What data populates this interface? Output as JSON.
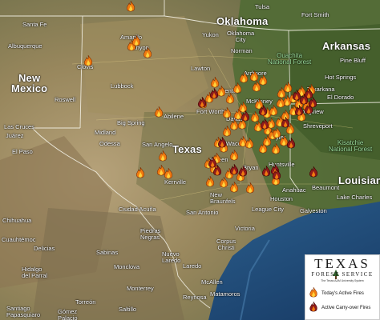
{
  "map": {
    "states": [
      {
        "key": "oklahoma",
        "name": "Oklahoma"
      },
      {
        "key": "arkansas",
        "name": "Arkansas"
      },
      {
        "key": "new_mexico",
        "name": "New\nMexico"
      },
      {
        "key": "texas",
        "name": "Texas"
      },
      {
        "key": "louisiana",
        "name": "Louisiana"
      }
    ],
    "national_forests": [
      {
        "key": "ouachita",
        "name": "Ouachita\nNational Forest"
      },
      {
        "key": "kisatchie",
        "name": "Kisatchie\nNational Forest"
      }
    ],
    "cities": [
      {
        "key": "tulsa",
        "name": "Tulsa"
      },
      {
        "key": "oklahoma_city",
        "name": "Oklahoma\nCity"
      },
      {
        "key": "lawton",
        "name": "Lawton"
      },
      {
        "key": "yukon",
        "name": "Yukon"
      },
      {
        "key": "ardmore",
        "name": "Ardmore"
      },
      {
        "key": "fort_smith",
        "name": "Fort Smith"
      },
      {
        "key": "amarillo",
        "name": "Amarillo"
      },
      {
        "key": "canyon",
        "name": "Canyon"
      },
      {
        "key": "santa_fe",
        "name": "Santa Fe"
      },
      {
        "key": "albuquerque",
        "name": "Albuquerque"
      },
      {
        "key": "hot_springs",
        "name": "Hot Springs"
      },
      {
        "key": "pine_bluff",
        "name": "Pine Bluff"
      },
      {
        "key": "el_dorado",
        "name": "El Dorado"
      },
      {
        "key": "lubbock",
        "name": "Lubbock"
      },
      {
        "key": "clovis",
        "name": "Clovis"
      },
      {
        "key": "roswell",
        "name": "Roswell"
      },
      {
        "key": "las_cruces",
        "name": "Las Cruces"
      },
      {
        "key": "juarez",
        "name": "Juárez"
      },
      {
        "key": "el_paso",
        "name": "El Paso"
      },
      {
        "key": "midland",
        "name": "Midland"
      },
      {
        "key": "odessa",
        "name": "Odessa"
      },
      {
        "key": "big_spring",
        "name": "Big Spring"
      },
      {
        "key": "abilene",
        "name": "Abilene"
      },
      {
        "key": "fort_worth",
        "name": "Fort Worth"
      },
      {
        "key": "dallas",
        "name": "Dallas"
      },
      {
        "key": "mckinney",
        "name": "McKinney"
      },
      {
        "key": "denton",
        "name": "Denton"
      },
      {
        "key": "tyler",
        "name": "Tyler"
      },
      {
        "key": "shreveport",
        "name": "Shreveport"
      },
      {
        "key": "longview",
        "name": "Longview"
      },
      {
        "key": "san_angelo",
        "name": "San Angelo"
      },
      {
        "key": "waco",
        "name": "Waco"
      },
      {
        "key": "killeen",
        "name": "Killeen"
      },
      {
        "key": "bryan",
        "name": "Bryan"
      },
      {
        "key": "huntsville",
        "name": "Huntsville"
      },
      {
        "key": "kerrville",
        "name": "Kerrville"
      },
      {
        "key": "new_braunfels",
        "name": "New\nBraunfels"
      },
      {
        "key": "san_antonio",
        "name": "San Antonio"
      },
      {
        "key": "houston",
        "name": "Houston"
      },
      {
        "key": "league_city",
        "name": "League City"
      },
      {
        "key": "galveston",
        "name": "Galveston"
      },
      {
        "key": "beaumont",
        "name": "Beaumont"
      },
      {
        "key": "lake_charles",
        "name": "Lake Charles"
      },
      {
        "key": "victoria",
        "name": "Victoria"
      },
      {
        "key": "corpus_christi",
        "name": "Corpus\nChristi"
      },
      {
        "key": "chihuahua",
        "name": "Chihuahua"
      },
      {
        "key": "cuauhtemoc",
        "name": "Cuauhtémoc"
      },
      {
        "key": "delicias",
        "name": "Delicias"
      },
      {
        "key": "ciudad_acuna",
        "name": "Ciudad Acuña"
      },
      {
        "key": "piedras_negras",
        "name": "Piedras\nNegras"
      },
      {
        "key": "nuevo_laredo",
        "name": "Nuevo\nLaredo"
      },
      {
        "key": "laredo",
        "name": "Laredo"
      },
      {
        "key": "hidalgo_del_parral",
        "name": "Hidalgo\ndel Parral"
      },
      {
        "key": "monclova",
        "name": "Monclova"
      },
      {
        "key": "monterrey",
        "name": "Monterrey"
      },
      {
        "key": "reynosa",
        "name": "Reynosa"
      },
      {
        "key": "matamoros",
        "name": "Matamoros"
      },
      {
        "key": "mcallen",
        "name": "McAllen"
      },
      {
        "key": "saltillo",
        "name": "Saltillo"
      },
      {
        "key": "torreon",
        "name": "Torreón"
      },
      {
        "key": "santiago_papasquiaro",
        "name": "Santiago\nPapasquiaro"
      },
      {
        "key": "gomez_palacio",
        "name": "Gómez\nPalacio"
      },
      {
        "key": "sabinas",
        "name": "Sabinas"
      },
      {
        "key": "anahuac",
        "name": "Anahuac"
      },
      {
        "key": "texarkana",
        "name": "Texarkana"
      },
      {
        "key": "norman",
        "name": "Norman"
      }
    ]
  },
  "legend": {
    "org_title": "TEXAS",
    "org_subtitle": "FOREST SERVICE",
    "org_tagline": "The Texas A&M University System",
    "items": [
      {
        "key": "today",
        "label": "Today's Active Fires",
        "color": "#f07a10"
      },
      {
        "key": "carryover",
        "label": "Active Carry-over Fires",
        "color": "#8e1b1b"
      }
    ]
  },
  "fires": {
    "today": 68,
    "carryover": 22
  }
}
